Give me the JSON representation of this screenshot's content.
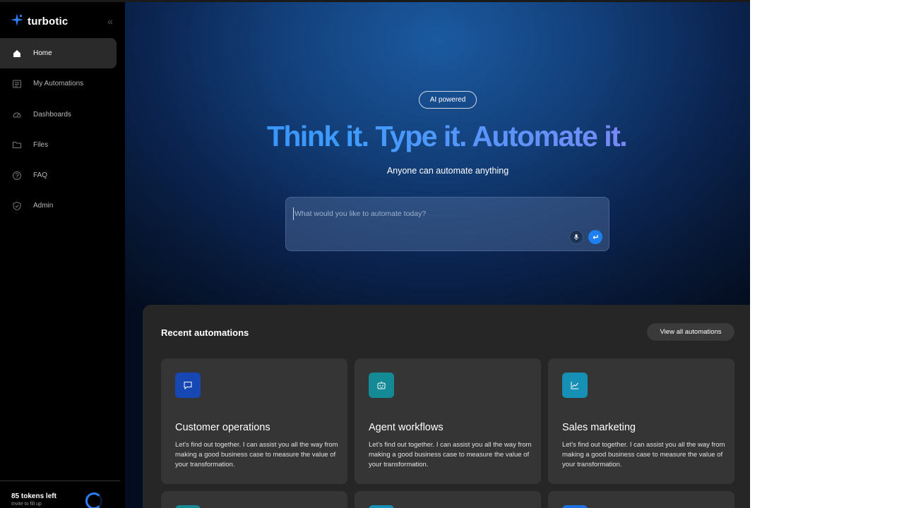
{
  "brand": {
    "name": "turbotic",
    "accent": "#2d7ff9"
  },
  "sidebar": {
    "collapse_icon": "double-chevron-left-icon",
    "items": [
      {
        "label": "Home",
        "icon": "home-icon",
        "active": true
      },
      {
        "label": "My Automations",
        "icon": "list-icon",
        "active": false
      },
      {
        "label": "Dashboards",
        "icon": "gauge-icon",
        "active": false
      },
      {
        "label": "Files",
        "icon": "folder-icon",
        "active": false
      },
      {
        "label": "FAQ",
        "icon": "question-circle-icon",
        "active": false
      },
      {
        "label": "Admin",
        "icon": "shield-icon",
        "active": false
      }
    ],
    "tokens": {
      "count_label": "85 tokens left",
      "sub_label": "Invite to fill up"
    }
  },
  "hero": {
    "badge": "AI powered",
    "headline": "Think it. Type it. Automate it.",
    "subheadline": "Anyone can automate anything",
    "prompt_placeholder": "What would you like to automate today?"
  },
  "recent": {
    "title": "Recent automations",
    "view_all": "View all automations",
    "cards": [
      {
        "title": "Customer operations",
        "desc": "Let's find out together. I can assist you all the way from making a good business case to measure the value of your transformation.",
        "icon": "chat-bubble-icon",
        "icon_bg": "#1747b3"
      },
      {
        "title": "Agent workflows",
        "desc": "Let's find out together. I can assist you all the way from making a good business case to measure the value of your transformation.",
        "icon": "robot-icon",
        "icon_bg": "#138a96"
      },
      {
        "title": "Sales marketing",
        "desc": "Let's find out together. I can assist you all the way from making a good business case to measure the value of your transformation.",
        "icon": "chart-line-icon",
        "icon_bg": "#1690b5"
      }
    ]
  }
}
